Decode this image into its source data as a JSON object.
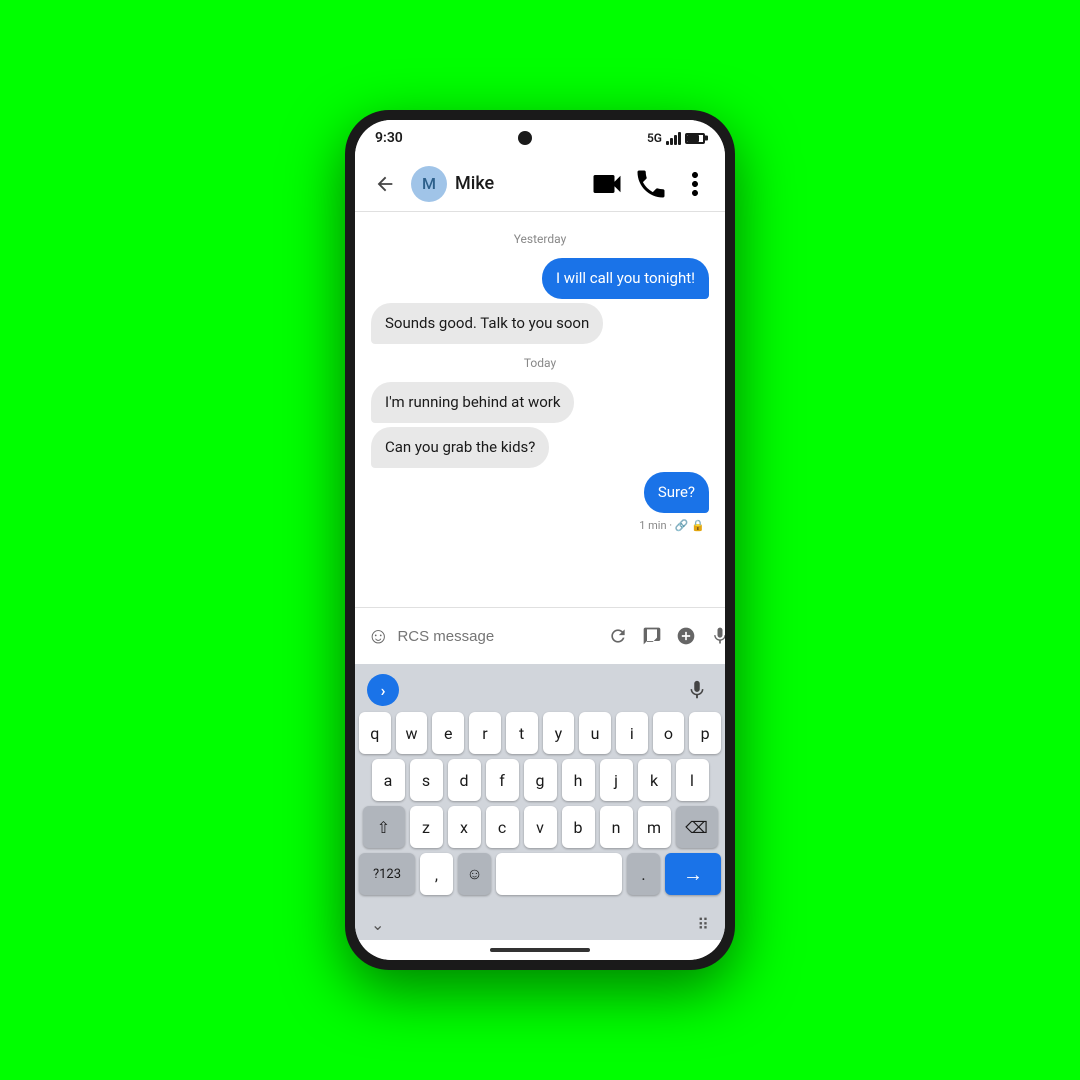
{
  "background": "#00ff00",
  "phone": {
    "status_bar": {
      "time": "9:30",
      "network": "5G"
    },
    "app_bar": {
      "back_label": "←",
      "contact_initial": "M",
      "contact_name": "Mike",
      "video_call_label": "video",
      "phone_call_label": "call",
      "more_label": "more"
    },
    "messages": [
      {
        "type": "date",
        "text": "Yesterday"
      },
      {
        "type": "sent",
        "text": "I will call you tonight!"
      },
      {
        "type": "received",
        "text": "Sounds good. Talk to you soon"
      },
      {
        "type": "date",
        "text": "Today"
      },
      {
        "type": "received",
        "text": "I'm running behind at work"
      },
      {
        "type": "received",
        "text": "Can you grab the kids?"
      },
      {
        "type": "sent",
        "text": "Sure?"
      }
    ],
    "message_meta": "1 min · 🔗 🔒",
    "input_area": {
      "placeholder": "RCS message",
      "emoji_label": "😊"
    },
    "keyboard": {
      "rows": [
        [
          "q",
          "w",
          "e",
          "r",
          "t",
          "y",
          "u",
          "i",
          "o",
          "p"
        ],
        [
          "a",
          "s",
          "d",
          "f",
          "g",
          "h",
          "j",
          "k",
          "l"
        ],
        [
          "z",
          "x",
          "c",
          "v",
          "b",
          "n",
          "m"
        ]
      ],
      "special_keys": {
        "shift": "⇧",
        "backspace": "⌫",
        "numbers": "?123",
        "comma": ",",
        "emoji": "☺",
        "period": ".",
        "send": "→",
        "mic": "🎤",
        "expand": ">"
      }
    }
  }
}
